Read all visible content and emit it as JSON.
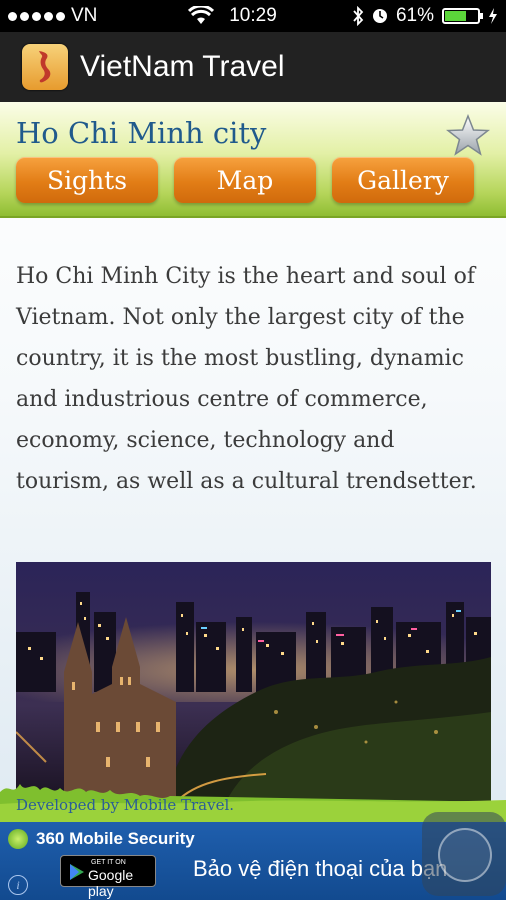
{
  "status_bar": {
    "carrier": "VN",
    "time": "10:29",
    "battery": "61%",
    "battery_level": 0.61
  },
  "app": {
    "title": "VietNam Travel"
  },
  "header": {
    "city": "Ho Chi Minh city",
    "tabs": [
      "Sights",
      "Map",
      "Gallery"
    ]
  },
  "description": "Ho Chi Minh City is the heart and soul of Vietnam. Not only the largest city of the country, it is the most bustling, dynamic and industrious centre of commerce, economy, science, technology and tourism, as well as a cultural trendsetter.",
  "footer": {
    "developer": "Developed by Mobile Travel."
  },
  "ad": {
    "brand": "360 Mobile Security",
    "store_small": "GET IT ON",
    "store_big": "Google play",
    "tagline": "Bảo vệ điện thoại của bạn"
  },
  "colors": {
    "accent_orange": "#e27d16",
    "title_blue": "#205a8c",
    "header_green": "#8fbd33",
    "ad_blue": "#1f5fae"
  }
}
